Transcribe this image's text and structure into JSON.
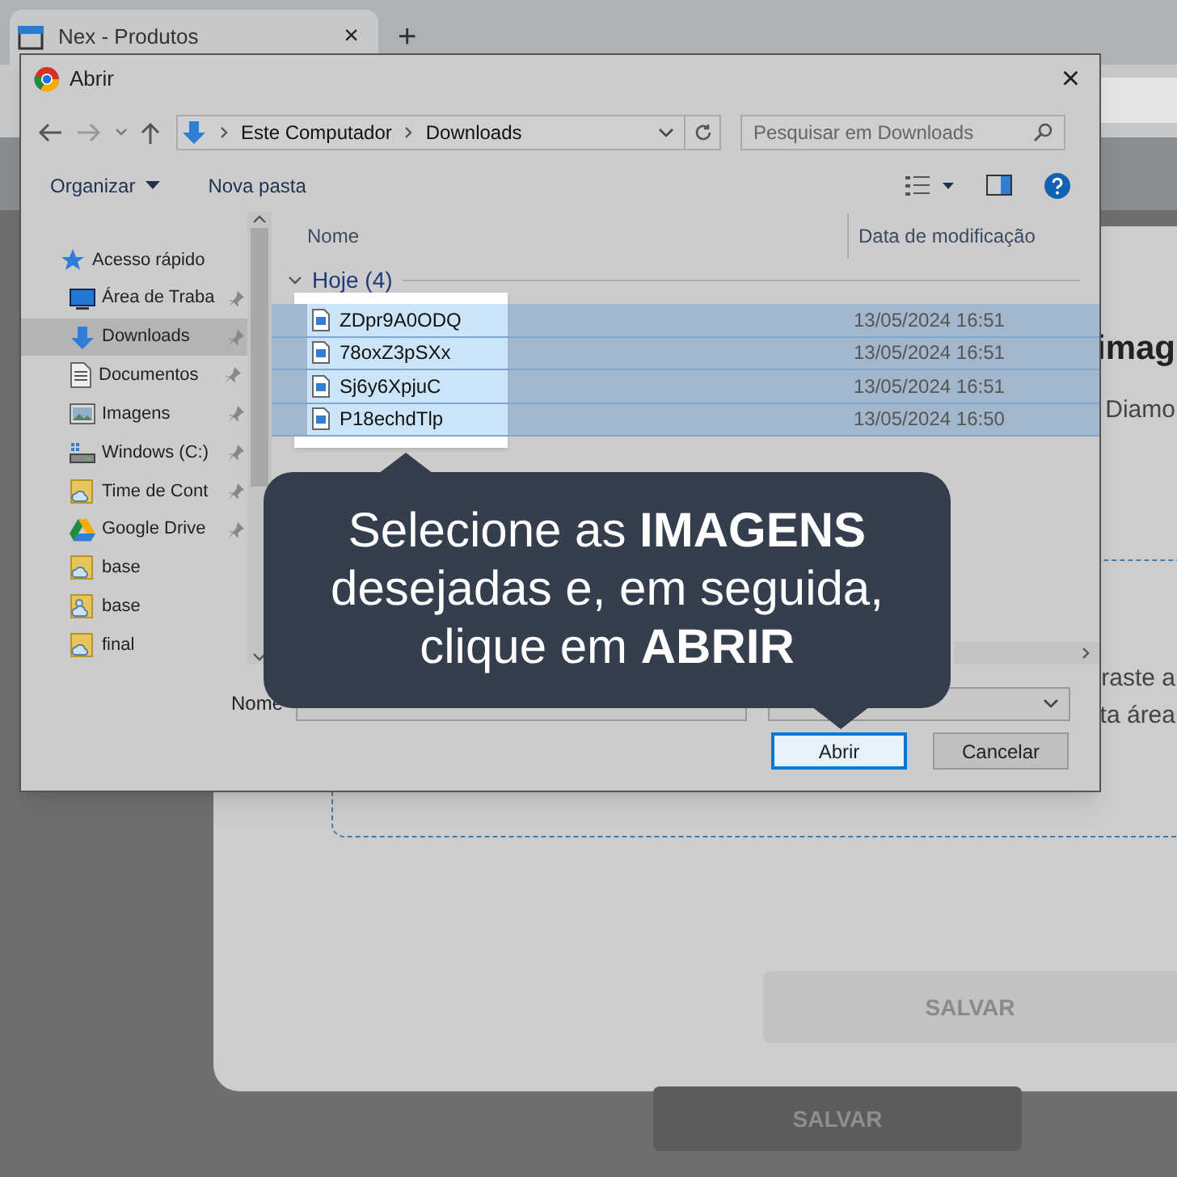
{
  "browser": {
    "tabs": [
      {
        "title": "Nex - Produtos",
        "selected": true,
        "close": "×"
      }
    ],
    "new_tab": "+"
  },
  "page": {
    "modal": {
      "heading": "imag",
      "subtitle": "Diamo",
      "drop_text": [
        "raste a",
        "ta área"
      ],
      "save_button": "SALVAR"
    },
    "save_button": "SALVAR"
  },
  "dialog": {
    "title": "Abrir",
    "close": "×",
    "path": [
      "Este Computador",
      "Downloads"
    ],
    "search": {
      "placeholder": "Pesquisar em Downloads"
    },
    "toolbar": [
      {
        "label": "Organizar",
        "dropdown": true
      },
      {
        "label": "Nova pasta",
        "dropdown": false
      }
    ],
    "nav": [
      {
        "label": "Acesso rápido",
        "kind": "star",
        "children": [
          {
            "label": "Área de Traba",
            "kind": "desktop",
            "pinned": true,
            "selected": false
          },
          {
            "label": "Downloads",
            "kind": "download",
            "pinned": true,
            "selected": true
          },
          {
            "label": "Documentos",
            "kind": "document",
            "pinned": true,
            "selected": false
          },
          {
            "label": "Imagens",
            "kind": "images",
            "pinned": true,
            "selected": false
          },
          {
            "label": "Windows (C:)",
            "kind": "drive",
            "pinned": true,
            "selected": false
          },
          {
            "label": "Time de Cont",
            "kind": "cloud-folder",
            "pinned": true,
            "selected": false
          },
          {
            "label": "Google Drive",
            "kind": "gdrive",
            "pinned": true,
            "selected": false
          },
          {
            "label": "base",
            "kind": "cloud-folder",
            "pinned": false,
            "selected": false
          },
          {
            "label": "base",
            "kind": "shared-folder",
            "pinned": false,
            "selected": false
          },
          {
            "label": "final",
            "kind": "cloud-folder",
            "pinned": false,
            "selected": false
          }
        ]
      }
    ],
    "columns": [
      "Nome",
      "Data de modificação"
    ],
    "group": {
      "label": "Hoje (4)",
      "expanded": true
    },
    "files": [
      {
        "name": "ZDpr9A0ODQ",
        "date": "13/05/2024 16:51",
        "selected": true
      },
      {
        "name": "78oxZ3pSXx",
        "date": "13/05/2024 16:51",
        "selected": true
      },
      {
        "name": "Sj6y6XpjuC",
        "date": "13/05/2024 16:51",
        "selected": true
      },
      {
        "name": "P18echdTlp",
        "date": "13/05/2024 16:50",
        "selected": true
      }
    ],
    "filename_label": "Nome",
    "buttons": [
      {
        "label": "Abrir",
        "default": true
      },
      {
        "label": "Cancelar",
        "default": false
      }
    ]
  },
  "callout": {
    "lines": [
      "Selecione as **IMAGENS**",
      "desejadas e, em seguida,",
      "clique em **ABRIR**"
    ]
  }
}
